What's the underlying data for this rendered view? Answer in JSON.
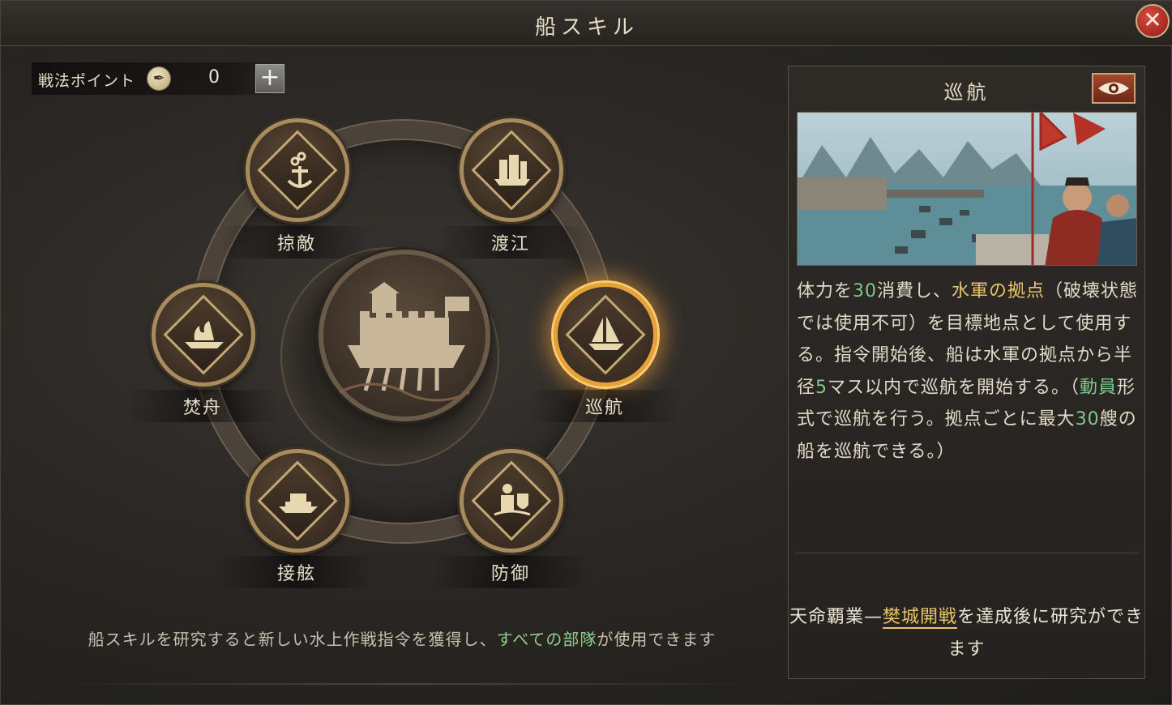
{
  "window": {
    "title": "船スキル",
    "close_label": "✕"
  },
  "points": {
    "label": "戦法ポイント",
    "icon": "feather-coin-icon",
    "value": "0",
    "add_label": "+"
  },
  "skills": [
    {
      "id": "ryoteki",
      "label": "掠敵",
      "icon": "chain-anchor-icon",
      "active": false
    },
    {
      "id": "toko",
      "label": "渡江",
      "icon": "junk-ship-icon",
      "active": false
    },
    {
      "id": "funshu",
      "label": "焚舟",
      "icon": "burning-boat-icon",
      "active": false
    },
    {
      "id": "junko",
      "label": "巡航",
      "icon": "sailing-ship-icon",
      "active": true
    },
    {
      "id": "setsugen",
      "label": "接舷",
      "icon": "boarding-boat-icon",
      "active": false
    },
    {
      "id": "bogyo",
      "label": "防御",
      "icon": "shield-soldier-icon",
      "active": false
    }
  ],
  "center": {
    "icon": "fortress-ship-icon"
  },
  "footer": {
    "text_before": "船スキルを研究すると新しい水上作戦指令を獲得し、",
    "highlight": "すべての部隊",
    "text_after": "が使用できます"
  },
  "detail": {
    "title": "巡航",
    "view_icon": "eye-icon",
    "image": "river-fleet-illustration",
    "desc": [
      {
        "t": "体力を",
        "c": ""
      },
      {
        "t": "30",
        "c": "teal"
      },
      {
        "t": "消費し、",
        "c": ""
      },
      {
        "t": "水軍の拠点",
        "c": "gold"
      },
      {
        "t": "（破壊状態では使用不可）を目標地点として使用する。指令開始後、船は水軍の拠点から半径",
        "c": ""
      },
      {
        "t": "5",
        "c": "teal"
      },
      {
        "t": "マス以内で巡航を開始する。（",
        "c": ""
      },
      {
        "t": "動員",
        "c": "teal"
      },
      {
        "t": "形式で巡航を行う。拠点ごとに最大",
        "c": ""
      },
      {
        "t": "30",
        "c": "teal"
      },
      {
        "t": "艘の船を巡航できる。）",
        "c": ""
      }
    ],
    "requirement": {
      "prefix": "天命覇業—",
      "link": "樊城開戦",
      "suffix": "を達成後に研究ができます"
    }
  },
  "colors": {
    "gold": "#e7c56b",
    "teal": "#7dc98d",
    "active_ring": "#e6a23a"
  }
}
